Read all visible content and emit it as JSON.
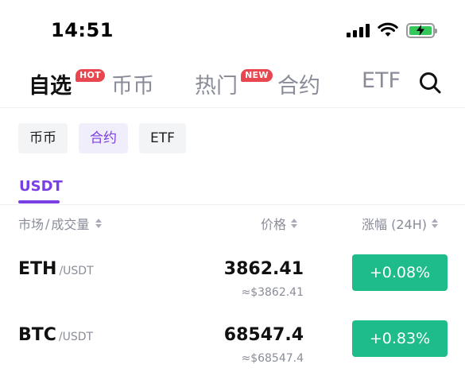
{
  "status_bar": {
    "time": "14:51",
    "icons": [
      "signal-icon",
      "wifi-icon",
      "battery-charging-icon"
    ]
  },
  "main_tabs": [
    {
      "label": "自选",
      "badge": "HOT",
      "active": true
    },
    {
      "label": "币币",
      "badge": "",
      "active": false
    },
    {
      "label": "热门",
      "badge": "NEW",
      "active": false
    },
    {
      "label": "合约",
      "badge": "",
      "active": false
    },
    {
      "label": "ETF",
      "badge": "",
      "active": false
    }
  ],
  "search_icon": "search-icon",
  "sub_tabs": [
    {
      "label": "币币",
      "active": false
    },
    {
      "label": "合约",
      "active": true
    },
    {
      "label": "ETF",
      "active": false
    }
  ],
  "quote_tab": {
    "label": "USDT",
    "active": true
  },
  "columns": {
    "market": "市场",
    "separator": "/",
    "volume": "成交量",
    "price": "价格",
    "change": "涨幅 (24H)"
  },
  "rows": [
    {
      "base": "ETH",
      "quote": "/USDT",
      "price": "3862.41",
      "fiat": "≈$3862.41",
      "change": "+0.08%"
    },
    {
      "base": "BTC",
      "quote": "/USDT",
      "price": "68547.4",
      "fiat": "≈$68547.4",
      "change": "+0.83%"
    }
  ],
  "colors": {
    "accent": "#7a3fe4",
    "up": "#1ebc8a",
    "badge": "#e8474f",
    "muted": "#8a8d99"
  }
}
